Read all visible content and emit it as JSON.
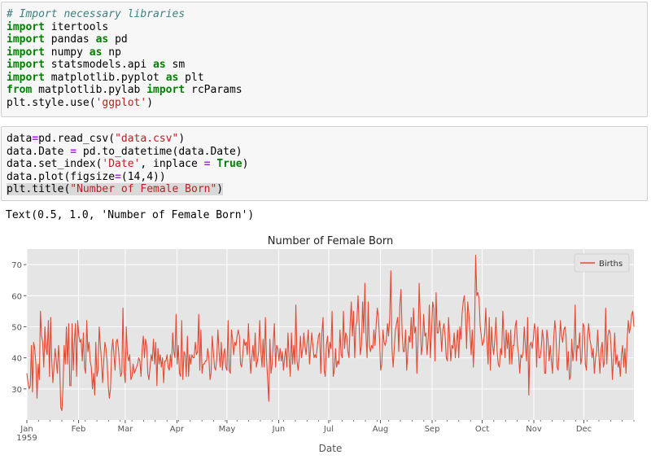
{
  "cells": [
    {
      "lines": [
        [
          [
            "cm",
            "# Import necessary libraries"
          ]
        ],
        [
          [
            "kw",
            "import"
          ],
          [
            "",
            " itertools"
          ]
        ],
        [
          [
            "kw",
            "import"
          ],
          [
            "",
            " pandas "
          ],
          [
            "kw",
            "as"
          ],
          [
            "",
            " pd"
          ]
        ],
        [
          [
            "kw",
            "import"
          ],
          [
            "",
            " numpy "
          ],
          [
            "kw",
            "as"
          ],
          [
            "",
            " np"
          ]
        ],
        [
          [
            "kw",
            "import"
          ],
          [
            "",
            " statsmodels.api "
          ],
          [
            "kw",
            "as"
          ],
          [
            "",
            " sm"
          ]
        ],
        [
          [
            "kw",
            "import"
          ],
          [
            "",
            " matplotlib.pyplot "
          ],
          [
            "kw",
            "as"
          ],
          [
            "",
            " plt"
          ]
        ],
        [
          [
            "kw",
            "from"
          ],
          [
            "",
            " matplotlib.pylab "
          ],
          [
            "kw",
            "import"
          ],
          [
            "",
            " rcParams"
          ]
        ],
        [
          [
            "",
            "plt.style.use("
          ],
          [
            "st",
            "'ggplot'"
          ],
          [
            "",
            ")"
          ]
        ]
      ]
    },
    {
      "lines": [
        [
          [
            "",
            "data"
          ],
          [
            "op",
            "="
          ],
          [
            "",
            "pd.read_csv("
          ],
          [
            "st",
            "\"data.csv\""
          ],
          [
            "",
            ")"
          ]
        ],
        [
          [
            "",
            "data.Date "
          ],
          [
            "op",
            "="
          ],
          [
            "",
            " pd.to_datetime(data.Date)"
          ]
        ],
        [
          [
            "",
            "data.set_index("
          ],
          [
            "st",
            "'Date'"
          ],
          [
            "",
            ", inplace "
          ],
          [
            "op",
            "="
          ],
          [
            "",
            " "
          ],
          [
            "kw",
            "True"
          ],
          [
            "",
            ")"
          ]
        ],
        [
          [
            "",
            "data.plot(figsize"
          ],
          [
            "op",
            "="
          ],
          [
            "",
            "(14,4))"
          ]
        ],
        [
          [
            "hl",
            "plt.title("
          ],
          [
            "hlst",
            "\"Number of Female Born\""
          ],
          [
            "hl",
            ")"
          ]
        ]
      ]
    }
  ],
  "output": {
    "text": "Text(0.5, 1.0, 'Number of Female Born')"
  },
  "chart_data": {
    "type": "line",
    "title": "Number of Female Born",
    "xlabel": "Date",
    "ylabel": "",
    "x_start": "1959-01-01",
    "x_end": "1959-12-31",
    "x_ticks": [
      {
        "label": "Jan",
        "sub": "1959",
        "date": "1959-01-01"
      },
      {
        "label": "Feb",
        "date": "1959-02-01"
      },
      {
        "label": "Mar",
        "date": "1959-03-01"
      },
      {
        "label": "Apr",
        "date": "1959-04-01"
      },
      {
        "label": "May",
        "date": "1959-05-01"
      },
      {
        "label": "Jun",
        "date": "1959-06-01"
      },
      {
        "label": "Jul",
        "date": "1959-07-01"
      },
      {
        "label": "Aug",
        "date": "1959-08-01"
      },
      {
        "label": "Sep",
        "date": "1959-09-01"
      },
      {
        "label": "Oct",
        "date": "1959-10-01"
      },
      {
        "label": "Nov",
        "date": "1959-11-01"
      },
      {
        "label": "Dec",
        "date": "1959-12-01"
      }
    ],
    "y_ticks": [
      30,
      40,
      50,
      60,
      70
    ],
    "ylim": [
      20,
      75
    ],
    "grid": true,
    "legend": {
      "position": "top-right"
    },
    "series": [
      {
        "name": "Births",
        "color": "#e24a33",
        "values": [
          35,
          32,
          30,
          31,
          44,
          29,
          45,
          43,
          38,
          27,
          38,
          33,
          55,
          47,
          45,
          37,
          50,
          43,
          41,
          52,
          34,
          53,
          39,
          32,
          37,
          43,
          39,
          35,
          44,
          38,
          24,
          23,
          31,
          44,
          38,
          50,
          38,
          51,
          31,
          31,
          51,
          36,
          45,
          51,
          34,
          52,
          47,
          45,
          46,
          39,
          48,
          37,
          35,
          52,
          42,
          45,
          39,
          37,
          30,
          35,
          28,
          45,
          34,
          36,
          50,
          44,
          39,
          32,
          39,
          45,
          43,
          39,
          31,
          27,
          30,
          42,
          46,
          41,
          36,
          45,
          46,
          43,
          38,
          34,
          35,
          56,
          36,
          32,
          50,
          41,
          39,
          41,
          33,
          34,
          38,
          35,
          36,
          37,
          38,
          40,
          39,
          34,
          43,
          47,
          40,
          46,
          44,
          35,
          33,
          37,
          41,
          39,
          46,
          38,
          45,
          31,
          43,
          38,
          41,
          37,
          40,
          32,
          39,
          39,
          41,
          37,
          36,
          41,
          37,
          48,
          42,
          40,
          54,
          38,
          44,
          35,
          34,
          52,
          33,
          42,
          41,
          34,
          47,
          34,
          41,
          38,
          41,
          40,
          40,
          45,
          41,
          42,
          54,
          36,
          49,
          35,
          38,
          38,
          39,
          39,
          43,
          40,
          33,
          35,
          47,
          42,
          37,
          36,
          40,
          49,
          42,
          37,
          45,
          36,
          41,
          43,
          37,
          36,
          52,
          36,
          35,
          49,
          46,
          41,
          45,
          44,
          47,
          49,
          47,
          38,
          37,
          41,
          46,
          44,
          45,
          41,
          51,
          42,
          35,
          40,
          44,
          39,
          48,
          37,
          39,
          42,
          52,
          42,
          37,
          46,
          37,
          53,
          40,
          33,
          26,
          46,
          35,
          38,
          45,
          51,
          37,
          44,
          43,
          39,
          43,
          39,
          42,
          36,
          40,
          43,
          37,
          48,
          40,
          34,
          48,
          38,
          44,
          38,
          57,
          39,
          36,
          40,
          47,
          40,
          43,
          48,
          44,
          41,
          45,
          49,
          38,
          43,
          48,
          44,
          40,
          41,
          40,
          44,
          47,
          48,
          35,
          48,
          53,
          36,
          34,
          44,
          47,
          40,
          45,
          43,
          55,
          34,
          36,
          43,
          37,
          39,
          38,
          49,
          41,
          40,
          55,
          43,
          48,
          47,
          42,
          40,
          51,
          58,
          47,
          55,
          40,
          50,
          52,
          60,
          50,
          41,
          44,
          58,
          48,
          64,
          47,
          40,
          58,
          44,
          42,
          44,
          43,
          49,
          44,
          51,
          56,
          53,
          46,
          36,
          38,
          49,
          45,
          44,
          46,
          51,
          47,
          53,
          68,
          43,
          37,
          43,
          49,
          51,
          53,
          42,
          57,
          62,
          48,
          42,
          42,
          49,
          36,
          42,
          47,
          45,
          53,
          43,
          56,
          48,
          50,
          35,
          45,
          64,
          53,
          41,
          44,
          54,
          47,
          48,
          41,
          46,
          57,
          40,
          48,
          58,
          56,
          39,
          61,
          48,
          48,
          52,
          49,
          42,
          49,
          51,
          47,
          40,
          39,
          53,
          46,
          39,
          44,
          43,
          48,
          40,
          45,
          49,
          40,
          50,
          46,
          54,
          58,
          60,
          54,
          43,
          58,
          54,
          48,
          41,
          49,
          37,
          47,
          73,
          60,
          61,
          59,
          50,
          47,
          44,
          45,
          48,
          56,
          45,
          38,
          53,
          36,
          50,
          44,
          41,
          46,
          53,
          42,
          38,
          37,
          43,
          41,
          55,
          47,
          40,
          49,
          43,
          48,
          38,
          49,
          38,
          44,
          44,
          50,
          52,
          44,
          41,
          35,
          41,
          40,
          42,
          50,
          44,
          39,
          53,
          28,
          44,
          45,
          43,
          46,
          51,
          49,
          37,
          50,
          40,
          40,
          43,
          49,
          46,
          35,
          35,
          49,
          46,
          39,
          44,
          39,
          35,
          46,
          52,
          48,
          37,
          36,
          44,
          52,
          47,
          45,
          49,
          50,
          47,
          36,
          42,
          33,
          34,
          46,
          39,
          43,
          57,
          39,
          44,
          43,
          48,
          38,
          40,
          51,
          50,
          38,
          36,
          47,
          51,
          46,
          44,
          40,
          43,
          35,
          40,
          42,
          49,
          41,
          35,
          43,
          45,
          37,
          39,
          56,
          38,
          47,
          49,
          48,
          42,
          33,
          40,
          48,
          38,
          41,
          37,
          39,
          34,
          41,
          44,
          37,
          43,
          35,
          46,
          52,
          48,
          50,
          54,
          55,
          50
        ]
      }
    ]
  }
}
